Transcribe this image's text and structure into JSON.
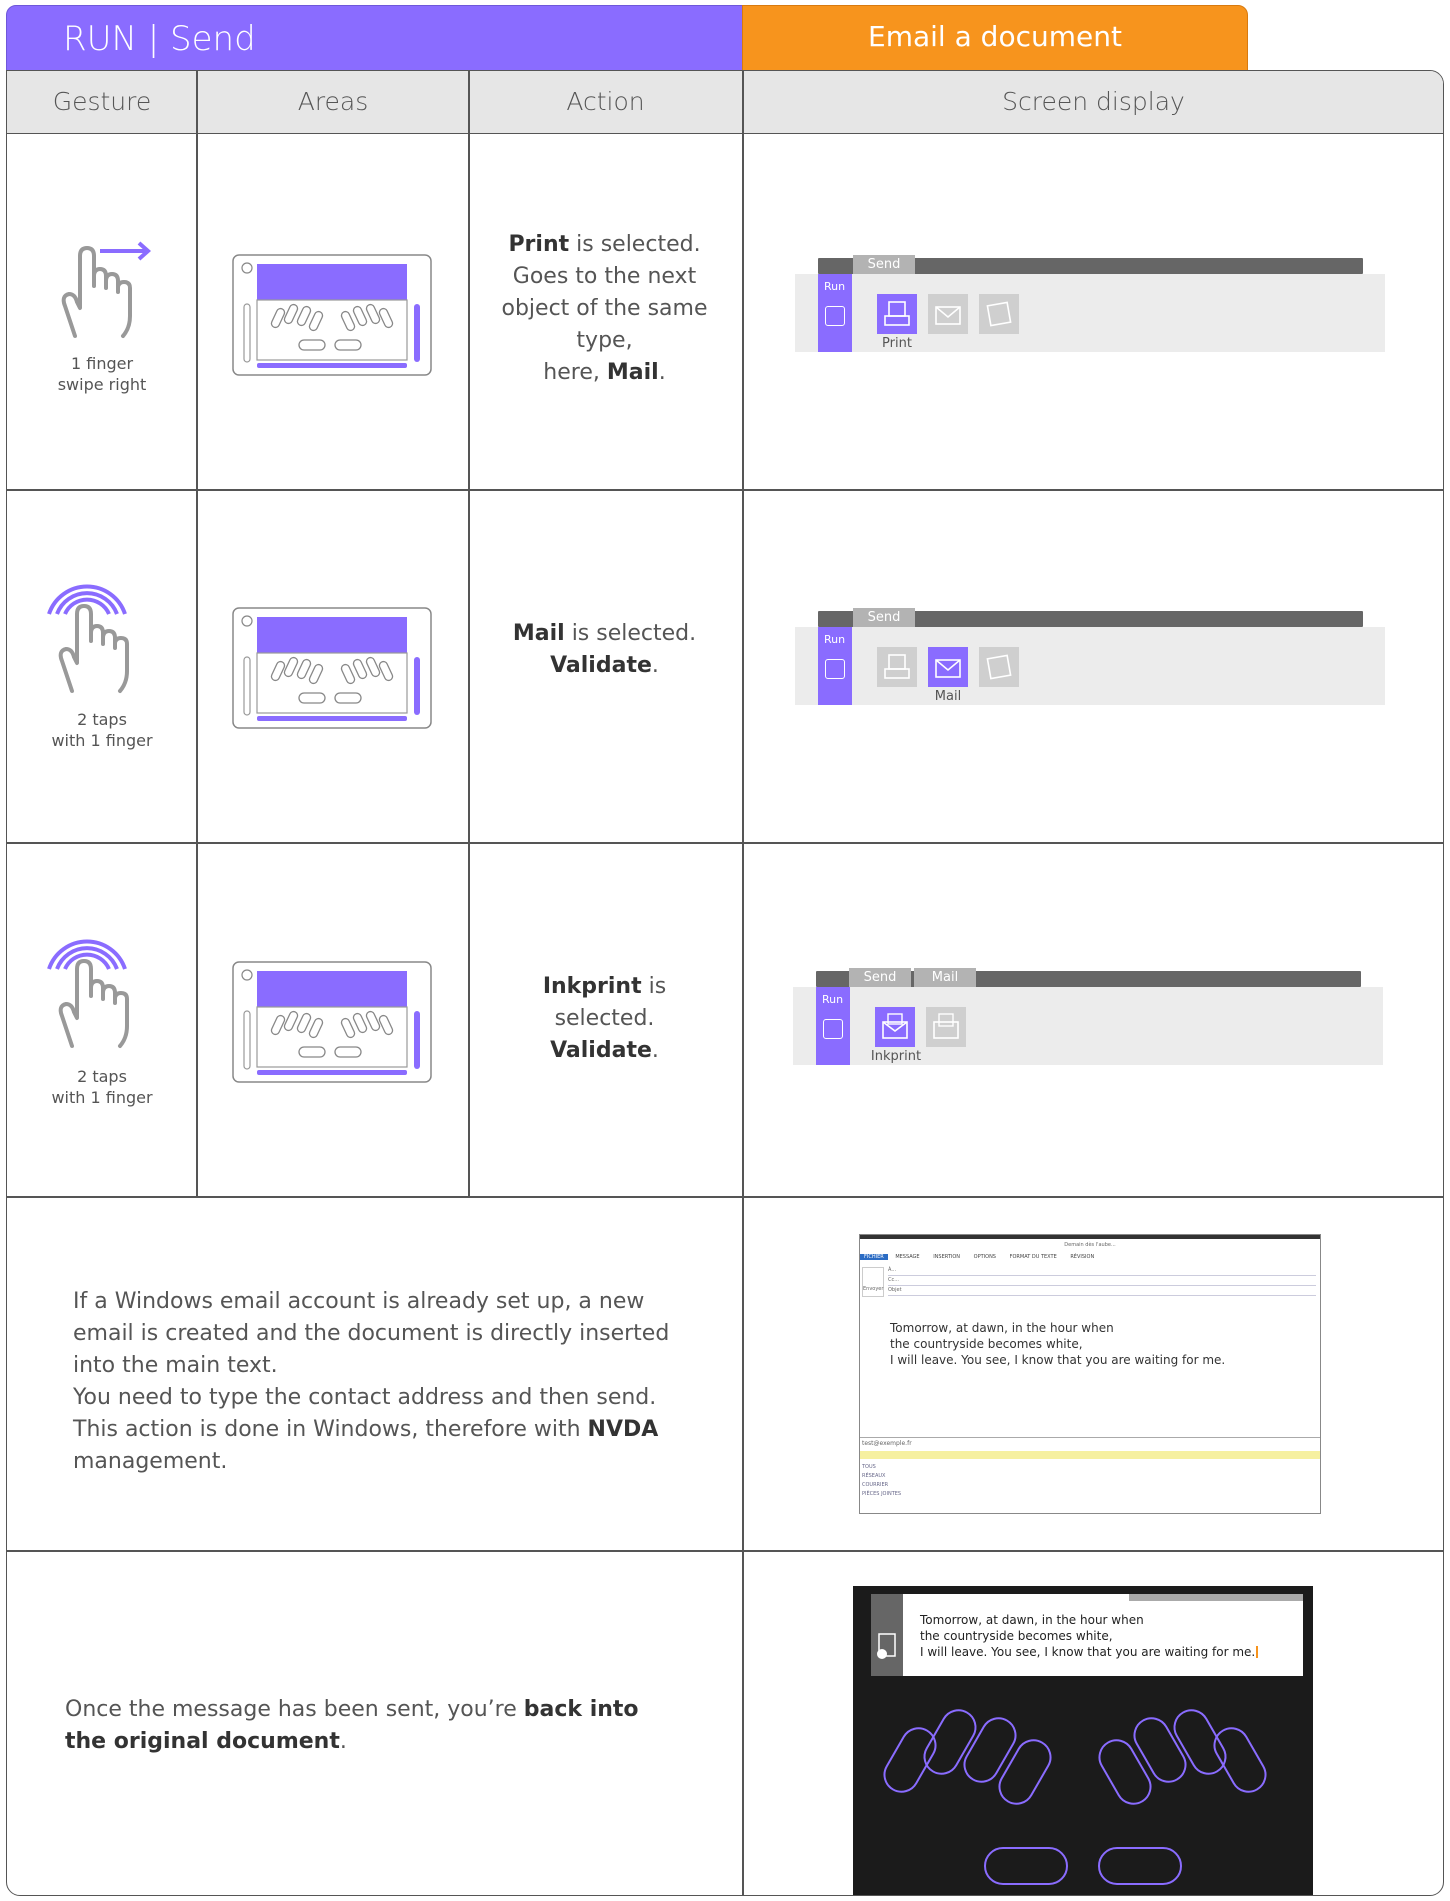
{
  "header": {
    "title": "RUN | Send",
    "topic": "Email a document"
  },
  "columns": [
    "Gesture",
    "Areas",
    "Action",
    "Screen display"
  ],
  "rows": [
    {
      "gesture_line1": "1 finger",
      "gesture_line2": "swipe right",
      "action_b1": "Print",
      "action_t1": " is selected.",
      "action_t2": "Goes to the next object of the same type,",
      "action_t3": "here, ",
      "action_b2": "Mail",
      "action_t4": ".",
      "screen": {
        "tabs": [
          "Send"
        ],
        "run": "Run",
        "label": "Print"
      }
    },
    {
      "gesture_line1": "2 taps",
      "gesture_line2": "with 1 finger",
      "action_b1": "Mail",
      "action_t1": " is selected.",
      "action_b2": "Validate",
      "action_t2": ".",
      "screen": {
        "tabs": [
          "Send"
        ],
        "run": "Run",
        "label": "Mail"
      }
    },
    {
      "gesture_line1": "2 taps",
      "gesture_line2": "with 1 finger",
      "action_b1": "Inkprint",
      "action_t1": " is selected.",
      "action_b2": "Validate",
      "action_t2": ".",
      "screen": {
        "tabs": [
          "Send",
          "Mail"
        ],
        "run": "Run",
        "label": "Inkprint"
      }
    }
  ],
  "row4": {
    "t1": "If a Windows email account is already set up, a new email is created and the document is directly inserted into the main text.",
    "t2": "You need to type the contact address and then send. This action is done in Windows, therefore with ",
    "b1": "NVDA",
    "t3": " management.",
    "email": {
      "title": "Demain dès l'aube...",
      "ribbon": [
        "FICHIER",
        "MESSAGE",
        "INSERTION",
        "OPTIONS",
        "FORMAT DU TEXTE",
        "RÉVISION"
      ],
      "fields": [
        "À...",
        "Cc...",
        "Objet"
      ],
      "send": "Envoyer",
      "body": [
        "Tomorrow, at dawn, in the hour when",
        "the countryside becomes white,",
        "I will leave. You see, I know that you are waiting for me."
      ],
      "footer_addr": "test@exemple.fr",
      "footer_items": [
        "TOUS",
        "RÉSEAUX",
        "COURRIER",
        "PIÈCES JOINTES"
      ]
    }
  },
  "row5": {
    "t1": "Once the message has been sent, you’re ",
    "b1": "back into the original document",
    "t2": ".",
    "doc_lines": [
      "Tomorrow, at dawn, in the hour when",
      "the countryside becomes white,",
      "I will leave. You see, I know that you are waiting for me."
    ]
  },
  "colors": {
    "accent": "#8a6cff",
    "orange": "#f7941d",
    "border": "#555555",
    "header_bg": "#e6e6e6"
  }
}
